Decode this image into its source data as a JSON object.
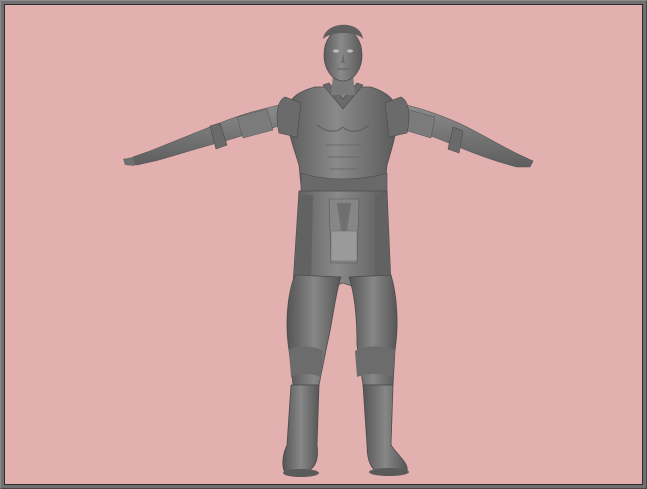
{
  "viewport": {
    "background_color": "#e2b0ae",
    "model_color": "#7d7d7d",
    "model_shadow_color": "#4f4f4f",
    "model_highlight_color": "#a3a3a3",
    "frame_color": "#707070"
  }
}
